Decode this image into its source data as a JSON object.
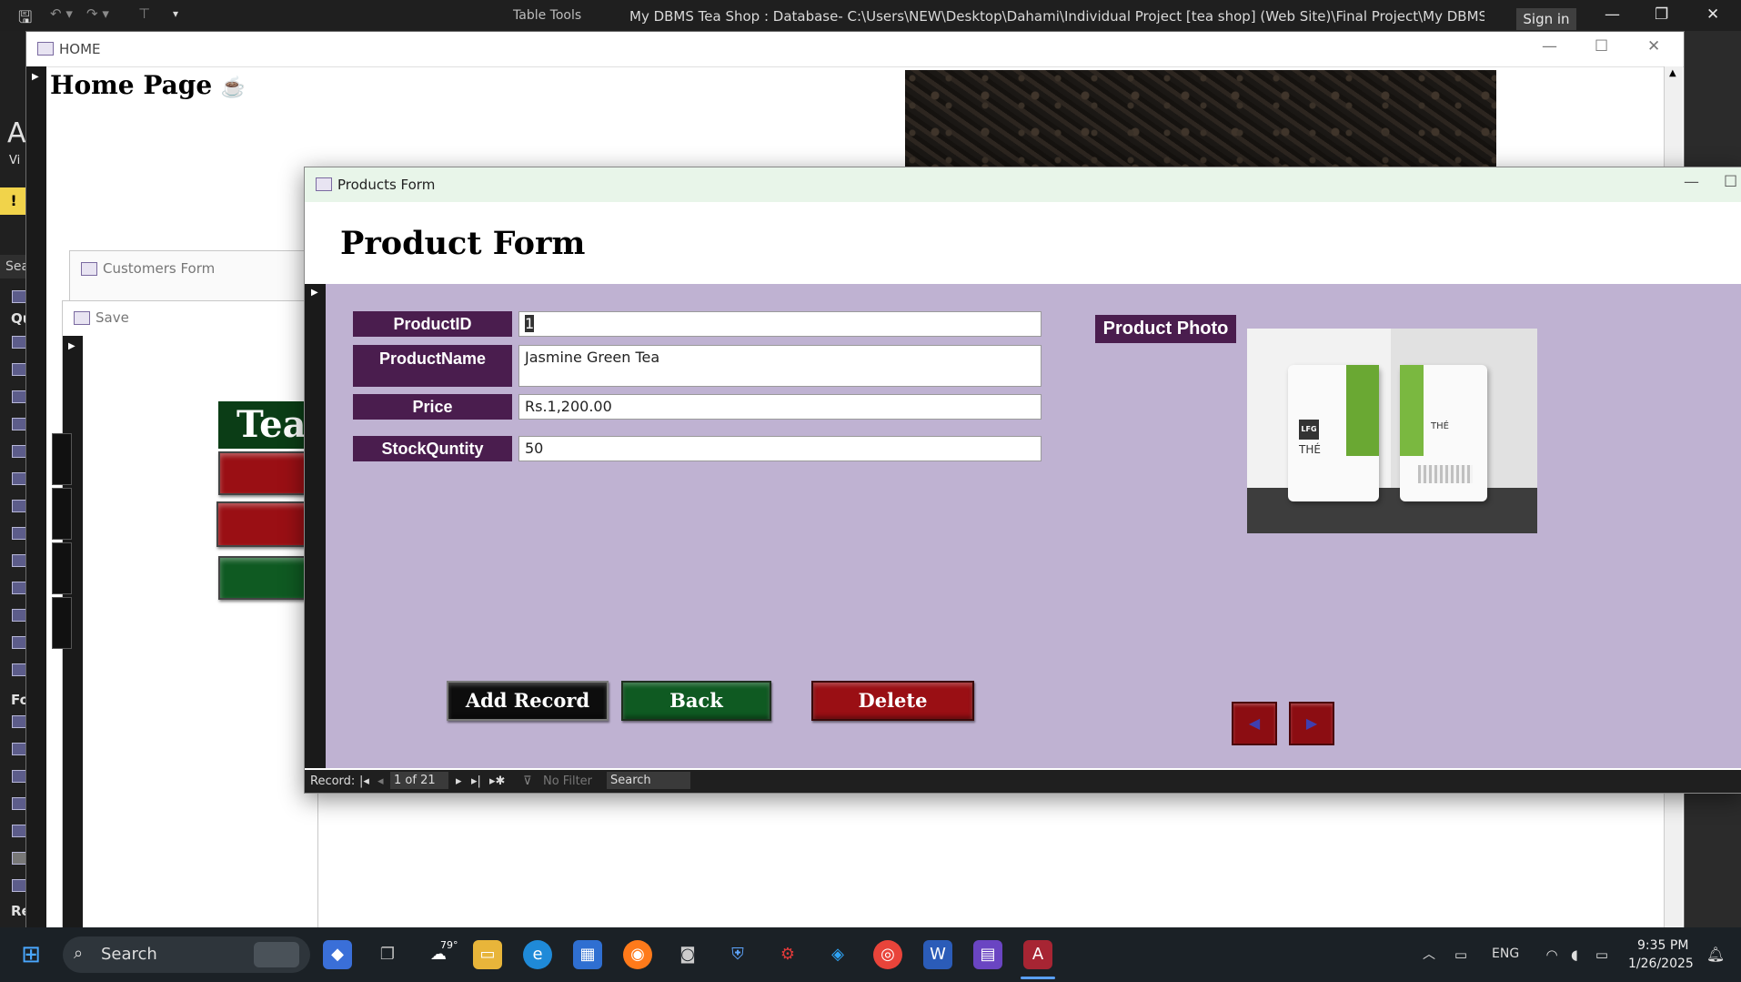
{
  "titlebar": {
    "context_tab": "Table Tools",
    "title": "My DBMS Tea Shop : Database- C:\\Users\\NEW\\Desktop\\Dahami\\Individual Project [tea shop] (Web Site)\\Final Project\\My DBMS Tea Shop.a...",
    "sign_in": "Sign in"
  },
  "nav_pane": {
    "groups": [
      "Al",
      "Qu",
      "Fo",
      "Re"
    ],
    "search_stub": "Sea",
    "view_stub": "Vi"
  },
  "home_window": {
    "caption": "HOME",
    "page_title": "Home Page"
  },
  "customers_window": {
    "caption": "Customers Form"
  },
  "save_window": {
    "caption": "Save",
    "logo_text": "Tea"
  },
  "products_window": {
    "caption": "Products Form",
    "form_title": "Product Form",
    "fields": [
      {
        "label": "ProductID",
        "value": "1"
      },
      {
        "label": "ProductName",
        "value": "Jasmine Green Tea"
      },
      {
        "label": "Price",
        "value": "Rs.1,200.00"
      },
      {
        "label": "StockQuntity",
        "value": "50"
      }
    ],
    "photo_label": "Product Photo",
    "photo_brand_1": "LFG",
    "photo_brand_2": "THÉ",
    "photo_brand_3": "THÉ",
    "buttons": {
      "add": "Add Record",
      "back": "Back",
      "delete": "Delete"
    },
    "colors": {
      "label_bg": "#4a1d4e",
      "body_bg": "#bfb2d2",
      "add": "#0d0d0d",
      "back": "#0f5a22",
      "delete": "#9a0f14"
    },
    "record_bar": {
      "label": "Record:",
      "position": "1 of 21",
      "filter": "No Filter",
      "search": "Search"
    }
  },
  "taskbar": {
    "search_placeholder": "Search",
    "weather": "79°",
    "language": "ENG",
    "time": "9:35 PM",
    "date": "1/26/2025"
  }
}
